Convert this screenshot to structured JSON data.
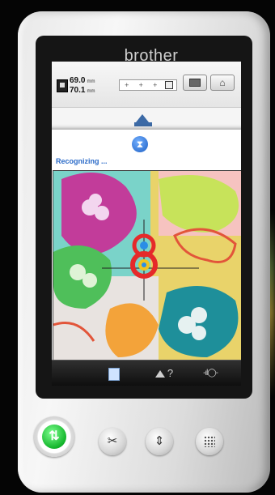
{
  "device": {
    "brand": "brother"
  },
  "topbar": {
    "size_width": "69.0",
    "size_height": "70.1",
    "unit": "mm",
    "zoom_controls": [
      "+",
      "+",
      "+"
    ]
  },
  "dialog": {
    "status": "Recognizing ...",
    "icon": "hourglass-icon"
  },
  "bottombar": {
    "presser_label": "-ıl◯-",
    "help_label": "?"
  },
  "buttons": {
    "start": "start-stop",
    "thread_cutter": "scissors",
    "needle": "needle-position",
    "speed": "speed-dots"
  },
  "colors": {
    "accent_blue": "#2a6ac8",
    "start_green": "#13b52b",
    "crosshair_red": "#e52a2a"
  }
}
